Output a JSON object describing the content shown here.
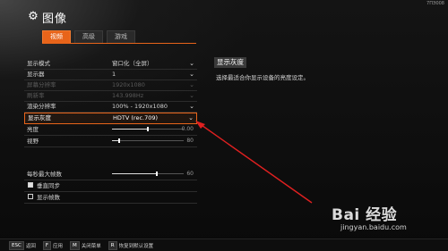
{
  "build_label": "7ПЭ008",
  "window": {
    "title": "图像",
    "icon": "gear-icon"
  },
  "tabs": [
    {
      "label": "视频",
      "active": true
    },
    {
      "label": "高级",
      "active": false
    },
    {
      "label": "游戏",
      "active": false
    }
  ],
  "settings": {
    "display_mode": {
      "label": "显示模式",
      "value": "窗口化（全屏）"
    },
    "monitor": {
      "label": "显示器",
      "value": "1"
    },
    "screen_resolution": {
      "label": "屏幕分辨率",
      "value": "1920x1080"
    },
    "refresh_rate": {
      "label": "刷新率",
      "value": "143.998Hz"
    },
    "render_resolution": {
      "label": "渲染分辨率",
      "value": "100% - 1920x1080"
    },
    "display_gamma": {
      "label": "显示灰度",
      "value": "HDTV (rec.709)"
    },
    "brightness": {
      "label": "亮度",
      "value": "0.00",
      "level": 0.5
    },
    "fov": {
      "label": "视野",
      "value": "80",
      "level": 0.1
    }
  },
  "group2": {
    "max_fps": {
      "label": "每秒最大帧数",
      "value": "60",
      "level": 0.62
    },
    "vsync": {
      "label": "垂直同步",
      "checked": true
    },
    "show_fps": {
      "label": "显示帧数",
      "checked": false
    }
  },
  "info_panel": {
    "title": "显示灰度",
    "description": "选择最适合你显示设备的亮度设定。"
  },
  "bottom_bar": [
    {
      "key": "ESC",
      "label": "返回"
    },
    {
      "key": "F",
      "label": "应用"
    },
    {
      "key": "M",
      "label": "关闭菜单"
    },
    {
      "key": "R",
      "label": "恢复到默认设置"
    }
  ],
  "watermark": {
    "main": "Bai 经验",
    "sub": "jingyan.baidu.com"
  },
  "colors": {
    "accent": "#e8641a",
    "annotation_arrow": "#e02020"
  }
}
